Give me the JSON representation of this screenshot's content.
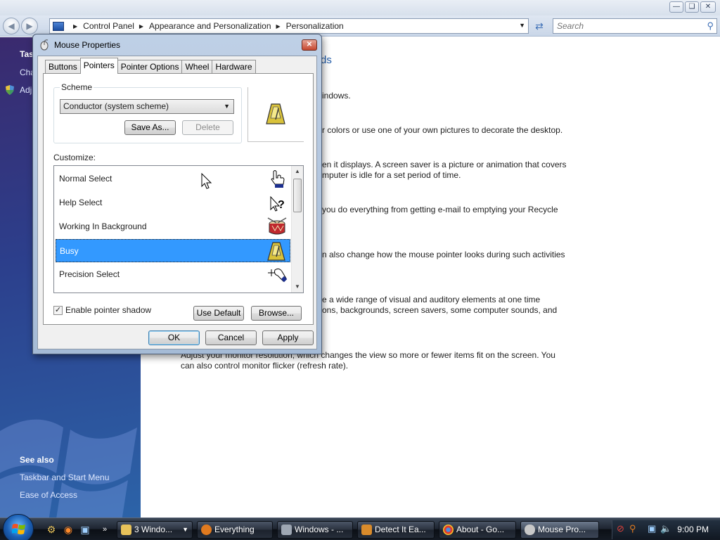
{
  "window": {
    "caption_buttons": [
      "minimize",
      "maximize",
      "close"
    ]
  },
  "address_bar": {
    "breadcrumb": [
      "Control Panel",
      "Appearance and Personalization",
      "Personalization"
    ]
  },
  "search": {
    "placeholder": "Search"
  },
  "left_pane": {
    "tasks_heading_partial": "Tas",
    "items_partial": [
      "Cha",
      "Adj"
    ],
    "see_also_heading": "See also",
    "see_also_links": [
      "Taskbar and Start Menu",
      "Ease of Access"
    ]
  },
  "content": {
    "title_partial": "ds",
    "lines": [
      "indows.",
      "r colors or use one of your own pictures to decorate the desktop.",
      "en it displays. A screen saver is a picture or animation that covers",
      "mputer is idle for a set period of time.",
      "you do everything from getting e-mail to emptying your Recycle",
      "n also change how the mouse pointer looks during such activities",
      "e a wide range of visual and auditory elements at one time",
      "ons, backgrounds, screen savers, some computer sounds, and",
      "Adjust your monitor resolution, which changes the view so more or fewer items fit on the screen. You",
      "can also control monitor flicker (refresh rate)."
    ]
  },
  "dialog": {
    "title": "Mouse Properties",
    "tabs": [
      "Buttons",
      "Pointers",
      "Pointer Options",
      "Wheel",
      "Hardware"
    ],
    "active_tab": "Pointers",
    "scheme": {
      "label": "Scheme",
      "selected": "Conductor (system scheme)",
      "save_as": "Save As...",
      "delete": "Delete"
    },
    "customize_label": "Customize:",
    "cursors": [
      {
        "name": "Normal Select",
        "icon": "hand-pointer-icon",
        "selected": false
      },
      {
        "name": "Help Select",
        "icon": "help-pointer-icon",
        "selected": false
      },
      {
        "name": "Working In Background",
        "icon": "drum-icon",
        "selected": false
      },
      {
        "name": "Busy",
        "icon": "metronome-icon",
        "selected": true
      },
      {
        "name": "Precision Select",
        "icon": "precision-pointer-icon",
        "selected": false
      }
    ],
    "enable_shadow": {
      "label": "Enable pointer shadow",
      "checked": true
    },
    "use_default": "Use Default",
    "browse": "Browse...",
    "ok": "OK",
    "cancel": "Cancel",
    "apply": "Apply"
  },
  "taskbar": {
    "tasks": [
      {
        "label": "3 Windo...",
        "icon": "folder-icon",
        "color": "#e7c25a"
      },
      {
        "label": "Everything",
        "icon": "magnifier-icon",
        "color": "#e07a1f"
      },
      {
        "label": "Windows - ...",
        "icon": "windows-mouse-icon",
        "color": "#9ea7b3"
      },
      {
        "label": "Detect It Ea...",
        "icon": "detect-icon",
        "color": "#d98b2b"
      },
      {
        "label": "About - Go...",
        "icon": "chrome-icon",
        "color": "#4a8fde"
      },
      {
        "label": "Mouse Pro...",
        "icon": "mouse-icon",
        "color": "#c8c8c8"
      }
    ],
    "active_task": "Mouse Pro...",
    "clock": "9:00 PM"
  },
  "colors": {
    "selection": "#3399ff",
    "link_title": "#1e5aa8",
    "taskbar": "#141a23"
  }
}
